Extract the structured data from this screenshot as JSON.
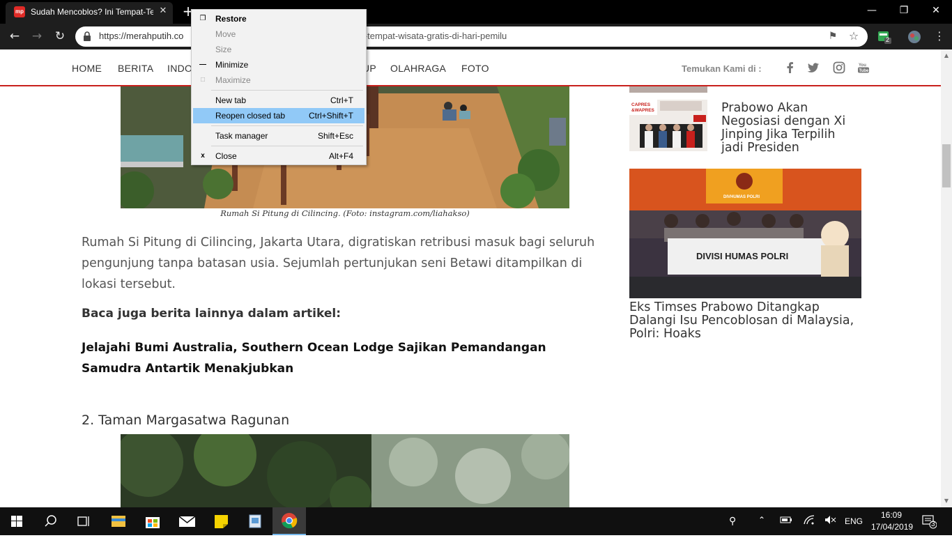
{
  "browser": {
    "tab_title": "Sudah Mencoblos? Ini Tempat-Te",
    "favicon_text": "mp",
    "tab_close": "✕",
    "new_tab": "+",
    "minimize": "—",
    "maximize": "❐",
    "close": "✕",
    "url_prefix": "https://merahputih.co",
    "url_suffix": "at-tempat-wisata-gratis-di-hari-pemilu",
    "extension_badge": "2"
  },
  "site": {
    "nav_items": [
      "HOME",
      "BERITA",
      "INDO",
      "UP",
      "OLAHRAGA",
      "FOTO"
    ],
    "find_us": "Temukan Kami di :",
    "accent": "#c8201c"
  },
  "article": {
    "caption": "Rumah Si Pitung di Cilincing. (Foto: instagram.com/liahakso)",
    "paragraph": "Rumah Si Pitung di Cilincing, Jakarta Utara, digratiskan retribusi masuk bagi seluruh pengunjung tanpa batasan usia. Sejumlah pertunjukan seni Betawi ditampilkan di lokasi tersebut.",
    "baca_juga": "Baca juga berita lainnya dalam artikel:",
    "related_link": "Jelajahi Bumi Australia, Southern Ocean Lodge Sajikan Pemandangan Samudra Antartik Menakjubkan",
    "section_heading": "2. Taman Margasatwa Ragunan"
  },
  "sidebar": {
    "item1_title": "Prabowo Akan Negosiasi dengan Xi Jinping Jika Terpilih jadi Presiden",
    "thumb1_label_a": "CAPRES",
    "thumb1_label_b": "&WAPRES",
    "big_image_banner": "DIVISI HUMAS POLRI",
    "big_image_top": "DIVHUMAS POLRI",
    "item2_title": "Eks Timses Prabowo Ditangkap Dalangi Isu Pencoblosan di Malaysia, Polri: Hoaks"
  },
  "context_menu": {
    "items": [
      {
        "label": "Restore",
        "shortcut": "",
        "icon": "restore-icon",
        "disabled": false,
        "bold": true
      },
      {
        "label": "Move",
        "shortcut": "",
        "icon": "",
        "disabled": true
      },
      {
        "label": "Size",
        "shortcut": "",
        "icon": "",
        "disabled": true
      },
      {
        "label": "Minimize",
        "shortcut": "",
        "icon": "minimize-icon",
        "disabled": false
      },
      {
        "label": "Maximize",
        "shortcut": "",
        "icon": "maximize-icon",
        "disabled": true
      },
      {
        "label": "New tab",
        "shortcut": "Ctrl+T"
      },
      {
        "label": "Reopen closed tab",
        "shortcut": "Ctrl+Shift+T",
        "highlighted": true
      },
      {
        "label": "Task manager",
        "shortcut": "Shift+Esc"
      },
      {
        "label": "Close",
        "shortcut": "Alt+F4",
        "icon": "close-icon"
      }
    ]
  },
  "taskbar": {
    "language": "ENG",
    "time": "16:09",
    "date": "17/04/2019",
    "notification_count": "3"
  }
}
